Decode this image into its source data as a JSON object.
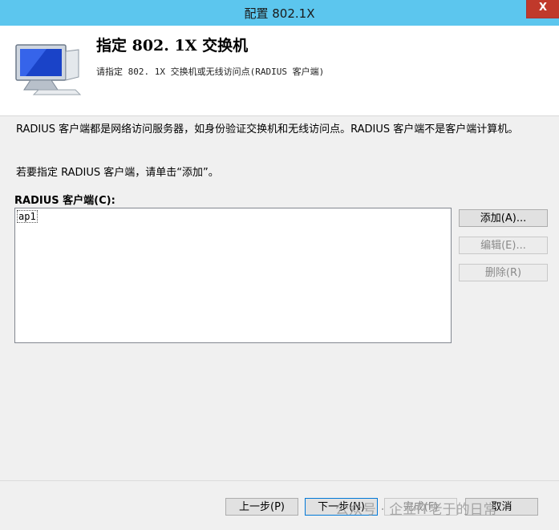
{
  "window": {
    "title": "配置 802.1X",
    "close_label": "X"
  },
  "header": {
    "title": "指定 802. 1X 交换机",
    "subtitle": "请指定 802. 1X 交换机或无线访问点(RADIUS 客户端)"
  },
  "content": {
    "description": "RADIUS 客户端都是网络访问服务器，如身份验证交换机和无线访问点。RADIUS 客户端不是客户端计算机。",
    "hint": "若要指定 RADIUS 客户端，请单击“添加”。",
    "list_label": "RADIUS 客户端(C):",
    "clients": [
      "ap1"
    ]
  },
  "buttons": {
    "add": "添加(A)...",
    "edit": "编辑(E)...",
    "delete": "删除(R)",
    "back": "上一步(P)",
    "next": "下一步(N)",
    "finish": "完成(F)",
    "cancel": "取消"
  },
  "watermark": "公众号 · 企业IT老于的日常",
  "icons": {
    "header": "monitor-icon"
  }
}
